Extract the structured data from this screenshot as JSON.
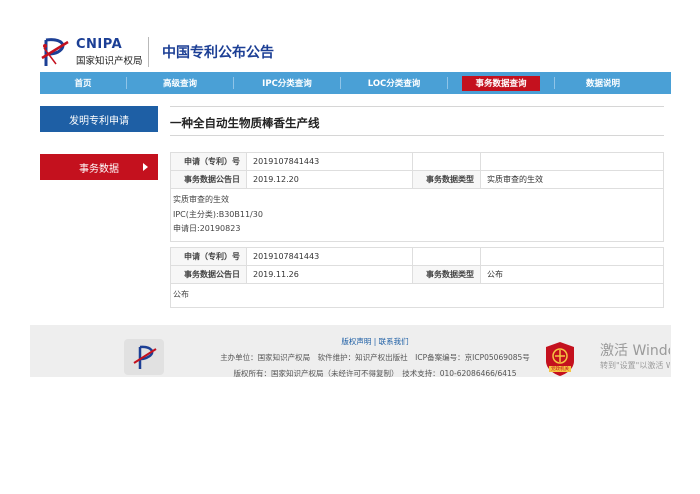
{
  "header": {
    "logo_en": "CNIPA",
    "logo_cn": "国家知识产权局",
    "site_title": "中国专利公布公告"
  },
  "nav": {
    "items": [
      {
        "label": "首页",
        "width": 86
      },
      {
        "label": "高级查询",
        "width": 106
      },
      {
        "label": "IPC分类查询",
        "width": 106
      },
      {
        "label": "LOC分类查询",
        "width": 106
      },
      {
        "label": "事务数据查询",
        "width": 106,
        "active": true
      },
      {
        "label": "数据说明",
        "width": 96
      }
    ],
    "colors": {
      "bar": "#4aa0d6",
      "active": "#c4111e"
    }
  },
  "sidebar": {
    "invent_label": "发明专利申请",
    "affairs_label": "事务数据"
  },
  "main": {
    "title": "一种全自动生物质棒香生产线",
    "records": [
      {
        "app_no_label": "申请（专利）号",
        "app_no": "2019107841443",
        "date_label": "事务数据公告日",
        "date": "2019.12.20",
        "type_label": "事务数据类型",
        "type": "实质审查的生效",
        "details": [
          "实质审查的生效",
          "IPC(主分类):B30B11/30",
          "申请日:20190823"
        ]
      },
      {
        "app_no_label": "申请（专利）号",
        "app_no": "2019107841443",
        "date_label": "事务数据公告日",
        "date": "2019.11.26",
        "type_label": "事务数据类型",
        "type": "公布",
        "details": [
          "公布"
        ]
      }
    ]
  },
  "footer": {
    "link_copyright": "版权声明",
    "link_sep": "|",
    "link_contact": "联系我们",
    "line2": "主办单位：国家知识产权局　软件维护：知识产权出版社　ICP备案编号：京ICP05069085号",
    "line3": "版权所有：国家知识产权局（未经许可不得复制）　技术支持：010-62086466/6415",
    "badge_label": "党政机关"
  },
  "watermark": {
    "line1": "激活 Windows",
    "line2": "转到\"设置\"以激活 Windows。"
  }
}
